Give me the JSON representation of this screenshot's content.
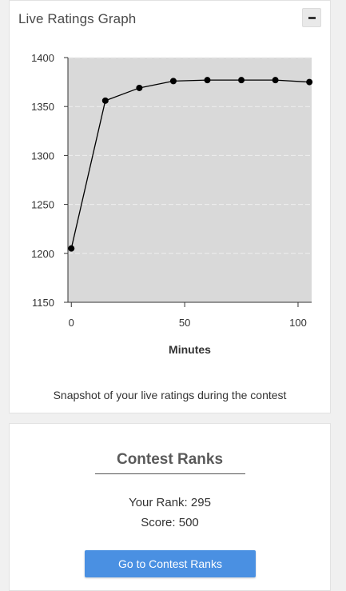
{
  "graph_panel": {
    "title": "Live Ratings Graph",
    "collapse_icon": "minus-icon",
    "caption": "Snapshot of your live ratings during the contest"
  },
  "chart_data": {
    "type": "line",
    "xlabel": "Minutes",
    "ylabel": "",
    "xlim": [
      -1.5,
      106
    ],
    "ylim": [
      1150,
      1400
    ],
    "xticks": [
      0,
      50,
      100
    ],
    "yticks": [
      1150,
      1200,
      1250,
      1300,
      1350,
      1400
    ],
    "grid": true,
    "series": [
      {
        "x": [
          0,
          15,
          30,
          45,
          60,
          75,
          90,
          105
        ],
        "y": [
          1205,
          1356,
          1369,
          1376,
          1377,
          1377,
          1377,
          1375
        ]
      }
    ]
  },
  "ranks_panel": {
    "title": "Contest Ranks",
    "rank_line": "Your Rank: 295",
    "score_line": "Score: 500",
    "button_label": "Go to Contest Ranks"
  },
  "colors": {
    "plot_background": "#d9d9d9",
    "line": "#000000",
    "button": "#4a90e2"
  }
}
